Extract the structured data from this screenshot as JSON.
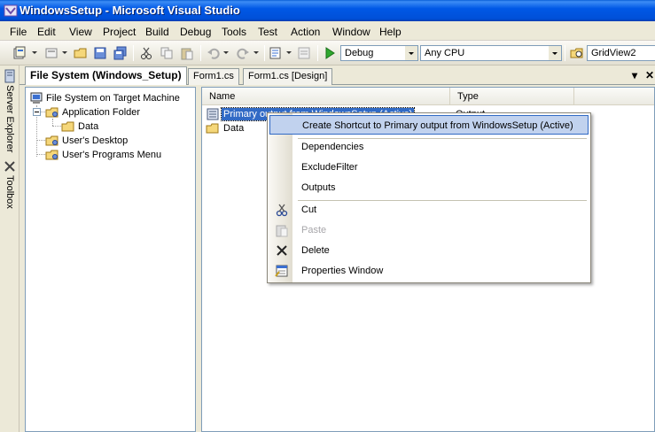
{
  "window": {
    "title": "WindowsSetup - Microsoft Visual Studio"
  },
  "menubar": {
    "items": [
      "File",
      "Edit",
      "View",
      "Project",
      "Build",
      "Debug",
      "Tools",
      "Test",
      "Action",
      "Window",
      "Help"
    ]
  },
  "toolbar": {
    "configuration": "Debug",
    "platform": "Any CPU",
    "find_value": "GridView2",
    "icons": [
      "add-project-icon",
      "add-item-icon",
      "open-icon",
      "save-icon",
      "save-all-icon",
      "cut-icon",
      "copy-icon",
      "paste-icon",
      "undo-icon",
      "redo-icon",
      "navigate-icon",
      "solution-configurations-icon",
      "start-debugging-icon",
      "find-in-files-icon"
    ]
  },
  "left_strip": {
    "tabs": [
      "Server Explorer",
      "Toolbox"
    ]
  },
  "doc_tabs": {
    "tabs": [
      "File System (Windows_Setup)",
      "Form1.cs",
      "Form1.cs [Design]"
    ],
    "active": 0,
    "dropdown_glyph": "▾",
    "close_glyph": "✕"
  },
  "tree": {
    "root": "File System on Target Machine",
    "nodes": [
      {
        "label": "Application Folder",
        "expanded": true
      },
      {
        "label": "Data"
      },
      {
        "label": "User's Desktop"
      },
      {
        "label": "User's Programs Menu"
      }
    ]
  },
  "list": {
    "columns": [
      "Name",
      "Type"
    ],
    "rows": [
      {
        "name": "Primary output from WindowsSetup (Active)",
        "type": "Output",
        "selected": true
      },
      {
        "name": "Data",
        "type": ""
      }
    ]
  },
  "context_menu": {
    "items": [
      {
        "label": "Create Shortcut to Primary output from WindowsSetup (Active)",
        "highlight": true
      },
      {
        "label": "Dependencies"
      },
      {
        "label": "ExcludeFilter"
      },
      {
        "label": "Outputs"
      },
      {
        "label": "Cut",
        "icon": "cut-icon"
      },
      {
        "label": "Paste",
        "icon": "paste-icon",
        "disabled": true
      },
      {
        "label": "Delete",
        "icon": "delete-icon"
      },
      {
        "label": "Properties Window",
        "icon": "properties-window-icon"
      }
    ]
  },
  "colors": {
    "titlebar": "#0058e6",
    "selection": "#316ac5",
    "menu_highlight": "#c1d2ee",
    "chrome": "#ece9d8"
  }
}
